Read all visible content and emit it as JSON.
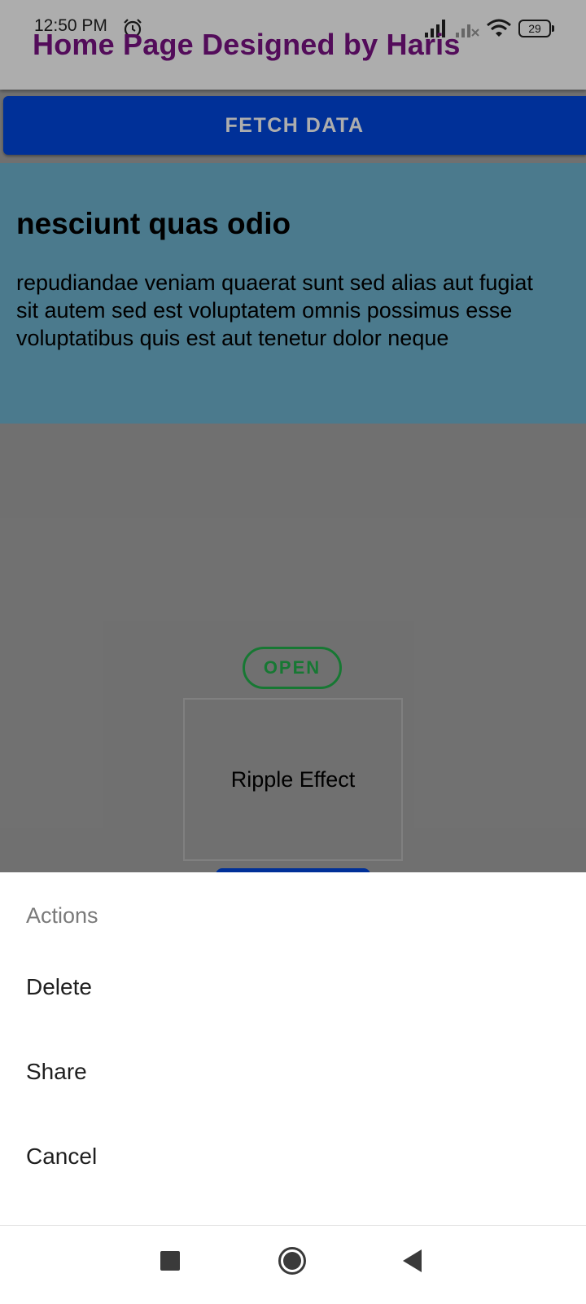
{
  "status_bar": {
    "time": "12:50 PM",
    "battery": "29",
    "icons": [
      "alarm-icon",
      "signal-icon",
      "signal-disabled-icon",
      "wifi-icon",
      "battery-icon"
    ]
  },
  "app_bar": {
    "title": "Home Page Designed by Haris"
  },
  "fetch_button": {
    "label": "FETCH DATA"
  },
  "post": {
    "title": "nesciunt quas odio",
    "body": "repudiandae veniam quaerat sunt sed alias aut fugiat sit autem sed est voluptatem omnis possimus esse voluptatibus quis est aut tenetur dolor neque"
  },
  "open_button": {
    "label": "OPEN"
  },
  "ripple_box": {
    "label": "Ripple Effect"
  },
  "action_sheet": {
    "title": "Actions",
    "items": [
      {
        "label": "Delete"
      },
      {
        "label": "Share"
      },
      {
        "label": "Cancel"
      }
    ]
  },
  "navigation_bar": {
    "icons": [
      "recents-icon",
      "home-icon",
      "back-icon"
    ]
  },
  "colors": {
    "app_title": "#7b1385",
    "fetch_button": "#0047e0",
    "post_card": "#6fb4d0",
    "open_button": "#22b24c"
  }
}
